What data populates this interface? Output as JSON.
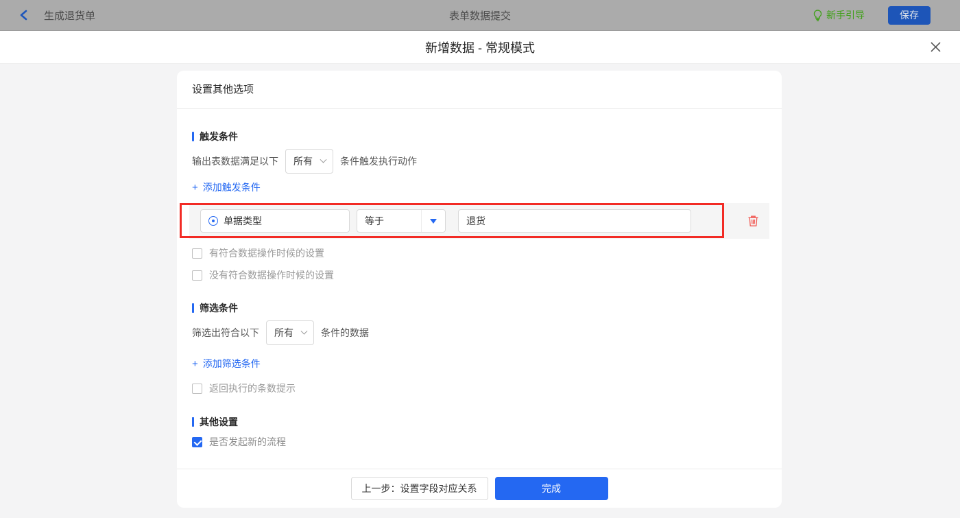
{
  "topbar": {
    "back_label": "生成退货单",
    "title": "表单数据提交",
    "guide_label": "新手引导",
    "save_label": "保存"
  },
  "modal": {
    "title": "新增数据 - 常规模式"
  },
  "panel": {
    "header": "设置其他选项",
    "trigger_section": {
      "heading": "触发条件",
      "sentence_prefix": "输出表数据满足以下",
      "match_select_value": "所有",
      "sentence_suffix": "条件触发执行动作",
      "add_link_label": "添加触发条件",
      "condition_row": {
        "field": "单据类型",
        "operator": "等于",
        "value": "退货"
      },
      "checkbox_has_match": {
        "label": "有符合数据操作时候的设置",
        "checked": false
      },
      "checkbox_no_match": {
        "label": "没有符合数据操作时候的设置",
        "checked": false
      }
    },
    "filter_section": {
      "heading": "筛选条件",
      "sentence_prefix": "筛选出符合以下",
      "match_select_value": "所有",
      "sentence_suffix": "条件的数据",
      "add_link_label": "添加筛选条件",
      "checkbox_count_tip": {
        "label": "返回执行的条数提示",
        "checked": false
      }
    },
    "other_section": {
      "heading": "其他设置",
      "checkbox_new_flow": {
        "label": "是否发起新的流程",
        "checked": true
      }
    },
    "footer": {
      "prev_label": "上一步：设置字段对应关系",
      "done_label": "完成"
    }
  },
  "icons": {
    "plus": "+"
  },
  "colors": {
    "accent_blue": "#2468f2",
    "highlight_red": "#f22b25",
    "guide_green": "#3fa017",
    "topbar_dimmed": "#ababab",
    "row_background": "#f5f5f5"
  }
}
